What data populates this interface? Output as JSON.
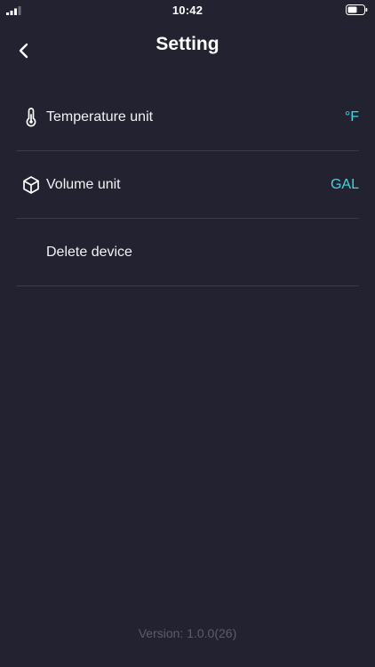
{
  "status_bar": {
    "time": "10:42"
  },
  "header": {
    "title": "Setting"
  },
  "settings": {
    "temperature_unit": {
      "label": "Temperature unit",
      "value": "°F",
      "icon": "thermometer-icon"
    },
    "volume_unit": {
      "label": "Volume unit",
      "value": "GAL",
      "icon": "cube-icon"
    },
    "delete_device": {
      "label": "Delete device"
    }
  },
  "footer": {
    "version": "Version: 1.0.0(26)"
  },
  "colors": {
    "background": "#232231",
    "accent": "#3fd6df",
    "divider": "#3b3a4b",
    "muted_text": "#5d5c6e"
  }
}
